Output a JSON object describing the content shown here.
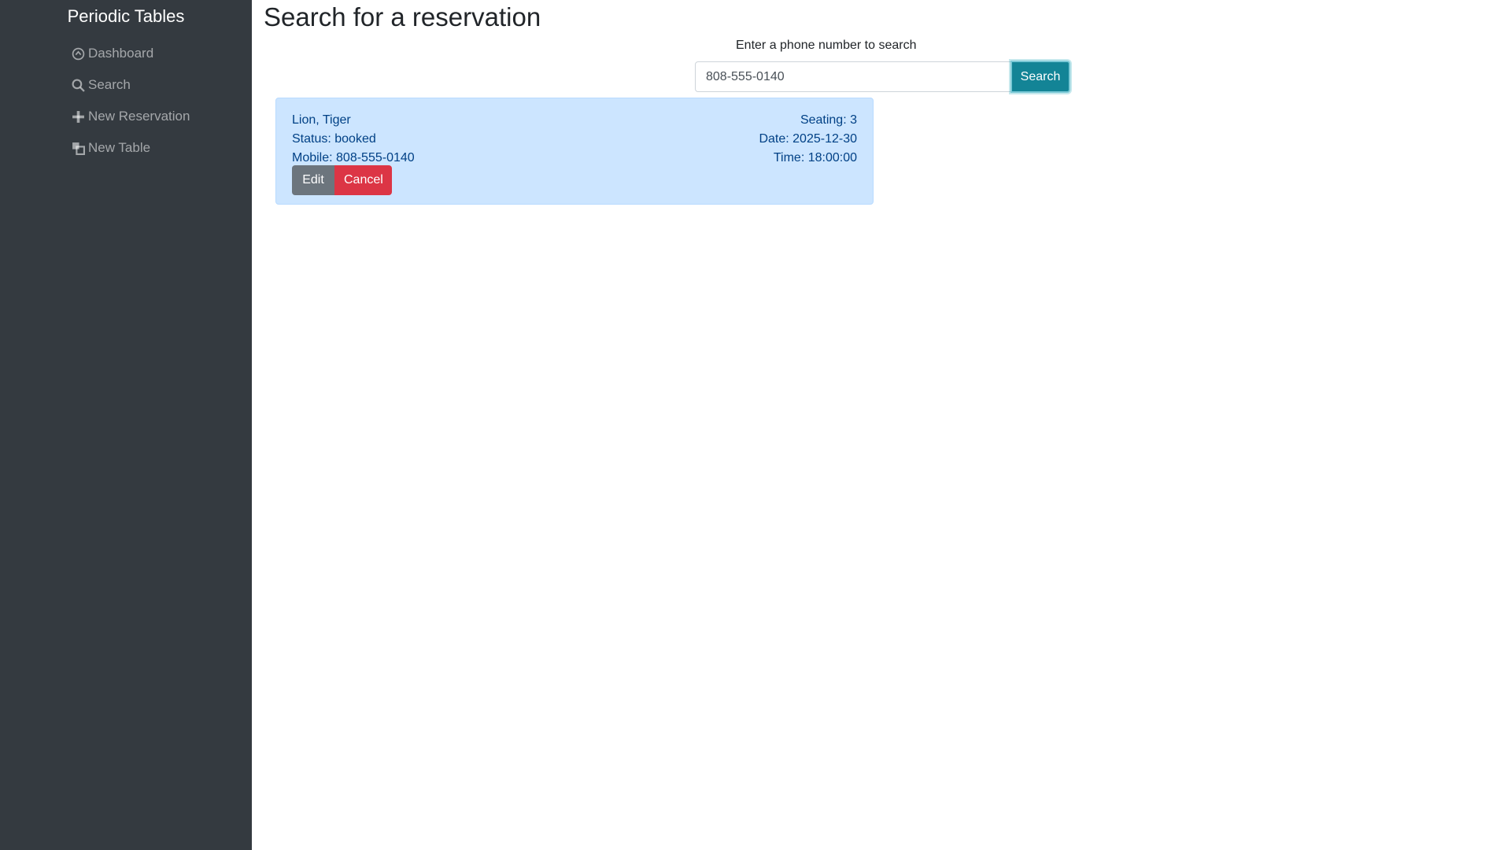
{
  "sidebar": {
    "brand": "Periodic Tables",
    "items": [
      {
        "label": "Dashboard",
        "icon": "dashboard-icon"
      },
      {
        "label": "Search",
        "icon": "search-icon"
      },
      {
        "label": "New Reservation",
        "icon": "plus-icon"
      },
      {
        "label": "New Table",
        "icon": "layers-icon"
      }
    ]
  },
  "main": {
    "title": "Search for a reservation",
    "search": {
      "label": "Enter a phone number to search",
      "value": "808-555-0140",
      "button_label": "Search"
    },
    "results": [
      {
        "name": "Lion, Tiger",
        "status": "Status: booked",
        "mobile": "Mobile: 808-555-0140",
        "seating": "Seating: 3",
        "date": "Date: 2025-12-30",
        "time": "Time: 18:00:00",
        "edit_label": "Edit",
        "cancel_label": "Cancel"
      }
    ]
  },
  "colors": {
    "sidebar_bg": "#343a40",
    "card_bg": "#cce5ff",
    "card_text": "#004085",
    "search_button": "#17a2b8",
    "edit_button": "#6c757d",
    "cancel_button": "#dc3545"
  }
}
